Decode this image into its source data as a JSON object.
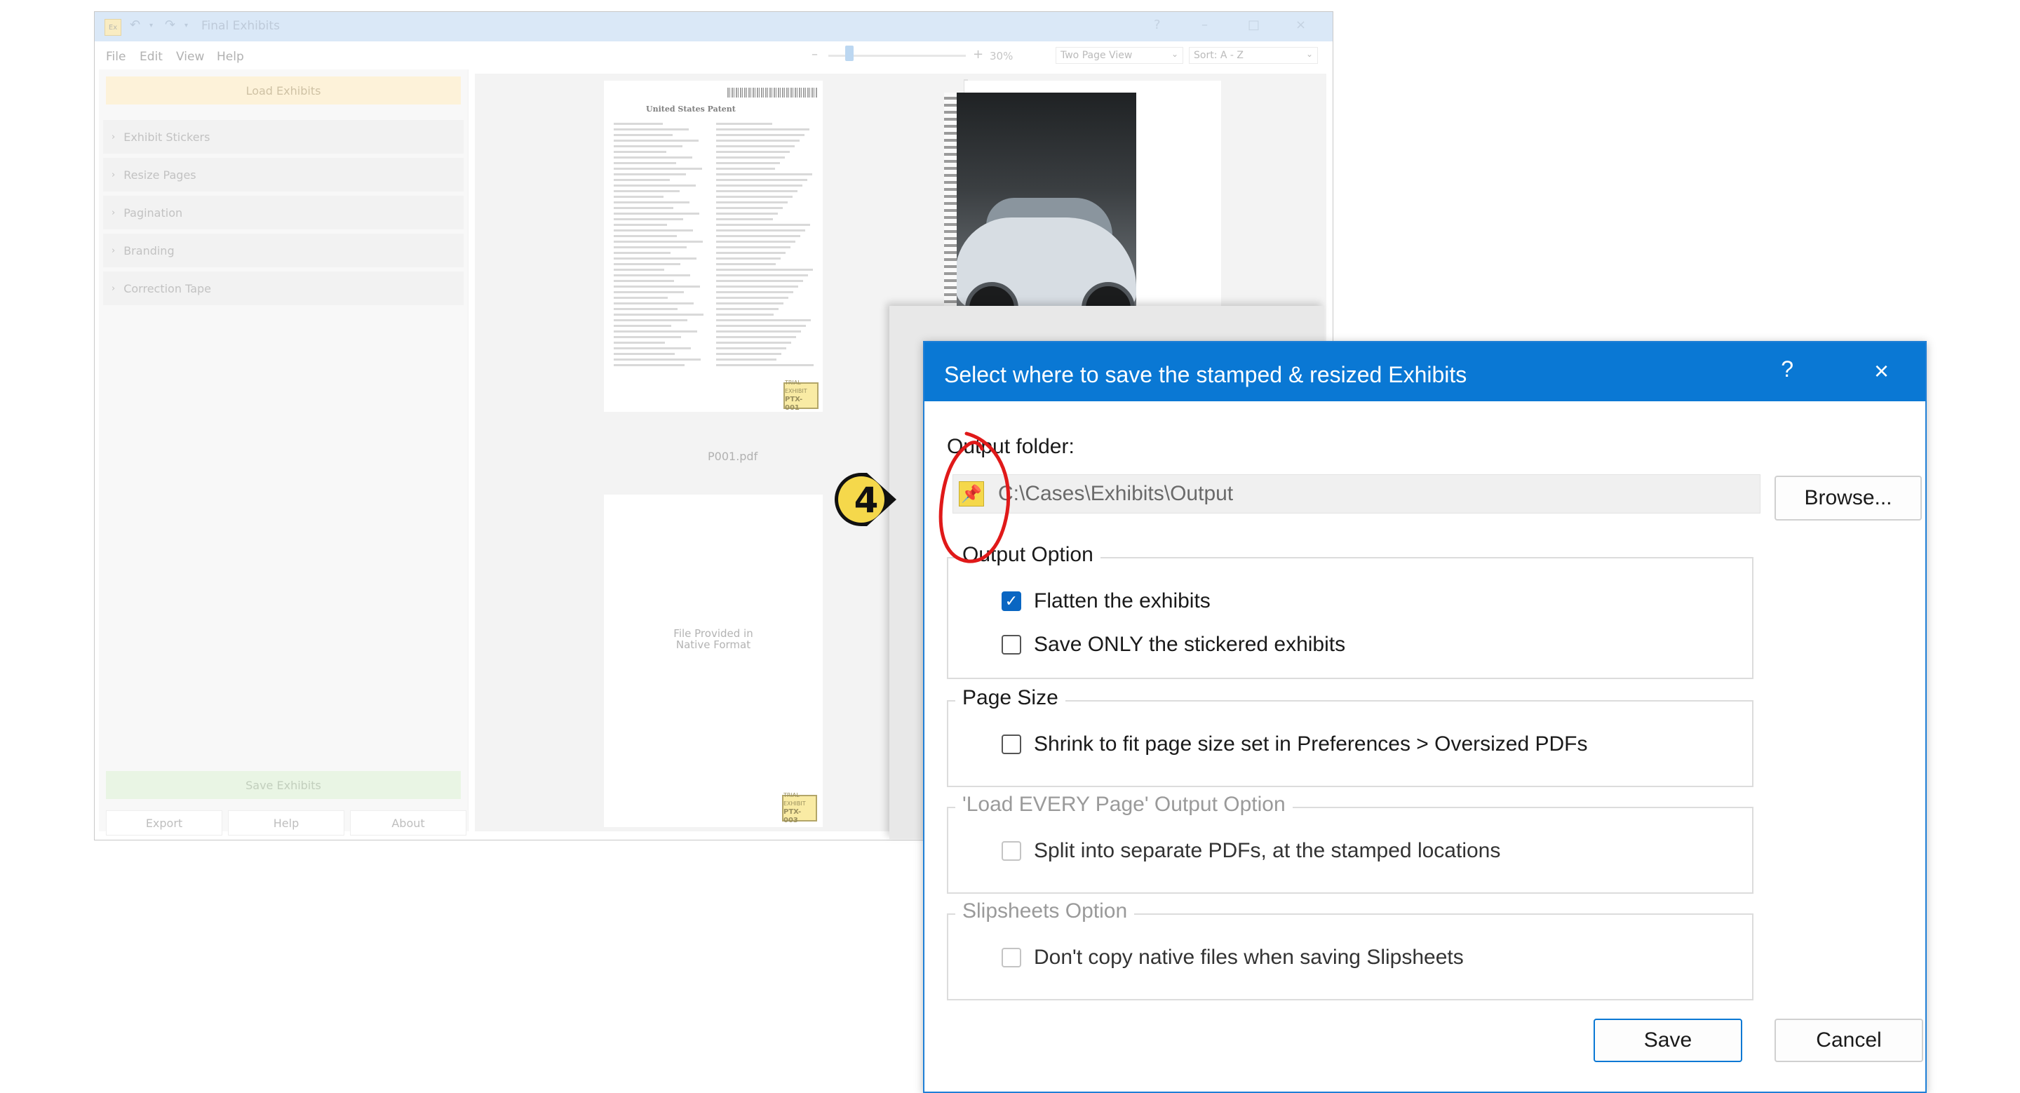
{
  "app": {
    "title": "Final Exhibits",
    "icon_text": "Ex",
    "undo_icon": "↶",
    "redo_icon": "↷",
    "window_buttons": [
      "?",
      "–",
      "□",
      "×"
    ],
    "menu": [
      "File",
      "Edit",
      "View",
      "Help"
    ],
    "zoom": {
      "minus": "–",
      "plus": "+",
      "level": "30%"
    },
    "view_mode": "Two Page View",
    "sort": "Sort: A - Z",
    "left_panel": {
      "load_button": "Load Exhibits",
      "sections": [
        "Exhibit Stickers",
        "Resize Pages",
        "Pagination",
        "Branding",
        "Correction Tape"
      ],
      "save_button": "Save Exhibits",
      "footer_buttons": [
        "Export",
        "Help",
        "About"
      ]
    },
    "pages": {
      "page1_caption": "P001.pdf",
      "page1_heading": "United States Patent",
      "sticker1": {
        "line1": "TRIAL EXHIBIT",
        "line2": "PTX-001"
      },
      "native_line1": "File Provided in",
      "native_line2": "Native Format",
      "sticker2": {
        "line1": "TRIAL EXHIBIT",
        "line2": "PTX-003"
      }
    }
  },
  "dialog": {
    "title": "Select where to save the stamped & resized Exhibits",
    "help": "?",
    "close": "×",
    "output_folder_label": "Output folder:",
    "output_path": "C:\\Cases\\Exhibits\\Output",
    "pin_icon": "📌",
    "browse_button": "Browse...",
    "groups": {
      "output_option": {
        "label": "Output Option",
        "options": [
          {
            "label": "Flatten the exhibits",
            "checked": true
          },
          {
            "label": "Save ONLY the stickered exhibits",
            "checked": false
          }
        ]
      },
      "page_size": {
        "label": "Page Size",
        "options": [
          {
            "label": "Shrink to fit page size set in Preferences > Oversized PDFs",
            "checked": false
          }
        ]
      },
      "load_every": {
        "label": "'Load EVERY Page' Output Option",
        "options": [
          {
            "label": "Split into separate PDFs, at the stamped locations",
            "checked": false
          }
        ]
      },
      "slipsheets": {
        "label": "Slipsheets Option",
        "options": [
          {
            "label": "Don't copy native files when saving Slipsheets",
            "checked": false
          }
        ]
      }
    },
    "save_button": "Save",
    "cancel_button": "Cancel",
    "checkmark": "✓"
  },
  "annotation": {
    "step_number": "4"
  },
  "colors": {
    "dialog_accent": "#0a78d4",
    "callout_fill": "#f5d84b",
    "ring_red": "#e01919",
    "load_button_bg": "#fdecc8",
    "save_button_bg": "#dff0d8"
  }
}
